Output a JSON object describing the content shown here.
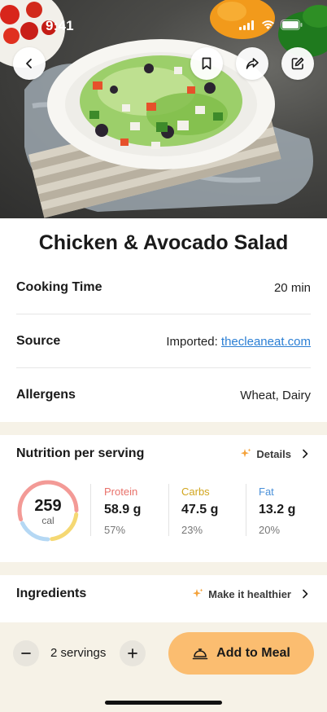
{
  "status_bar": {
    "time": "9:41"
  },
  "hero": {
    "icons": {
      "back": "chevron-left-icon",
      "bookmark": "bookmark-icon",
      "share": "share-icon",
      "edit": "edit-icon"
    }
  },
  "recipe": {
    "title": "Chicken & Avocado Salad",
    "cooking_time_label": "Cooking Time",
    "cooking_time_value": "20 min",
    "source_label": "Source",
    "source_prefix": "Imported:",
    "source_link": "thecleaneat.com",
    "allergens_label": "Allergens",
    "allergens_value": "Wheat, Dairy"
  },
  "nutrition": {
    "heading": "Nutrition per serving",
    "details_label": "Details",
    "calories": "259",
    "calories_unit": "cal",
    "macros": [
      {
        "name": "Protein",
        "amount": "58.9 g",
        "percent": "57%",
        "color": "#e8716a"
      },
      {
        "name": "Carbs",
        "amount": "47.5 g",
        "percent": "23%",
        "color": "#d1a51d"
      },
      {
        "name": "Fat",
        "amount": "13.2 g",
        "percent": "20%",
        "color": "#4a90d9"
      }
    ],
    "ring_colors": {
      "protein": "#f39a96",
      "carbs": "#f5d873",
      "fat": "#b5d8f4"
    }
  },
  "ingredients": {
    "heading": "Ingredients",
    "healthier_label": "Make it healthier"
  },
  "bottom": {
    "servings": "2 servings",
    "add_label": "Add to Meal"
  },
  "colors": {
    "accent": "#fbbd70",
    "sparkle": "#f4a23a",
    "band": "#f6f2e7",
    "link": "#2b7fd4"
  }
}
